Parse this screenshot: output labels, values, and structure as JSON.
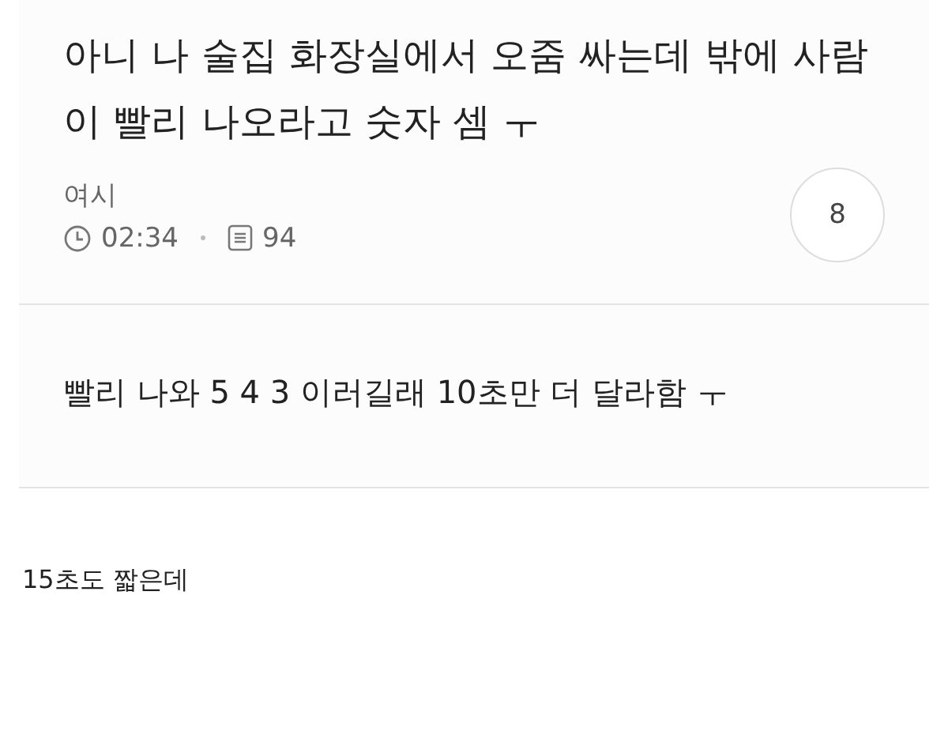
{
  "post": {
    "title": "아니 나 술집 화장실에서 오줌 싸는데 밖에 사람이 빨리 나오라고 숫자 셈 ㅜ",
    "author": "여시",
    "time": "02:34",
    "views": "94",
    "comment_count": "8",
    "body": "빨리 나와 5 4 3 이러길래 10초만 더 달라함 ㅜ"
  },
  "comments": [
    {
      "text": "15초도 짧은데"
    }
  ]
}
